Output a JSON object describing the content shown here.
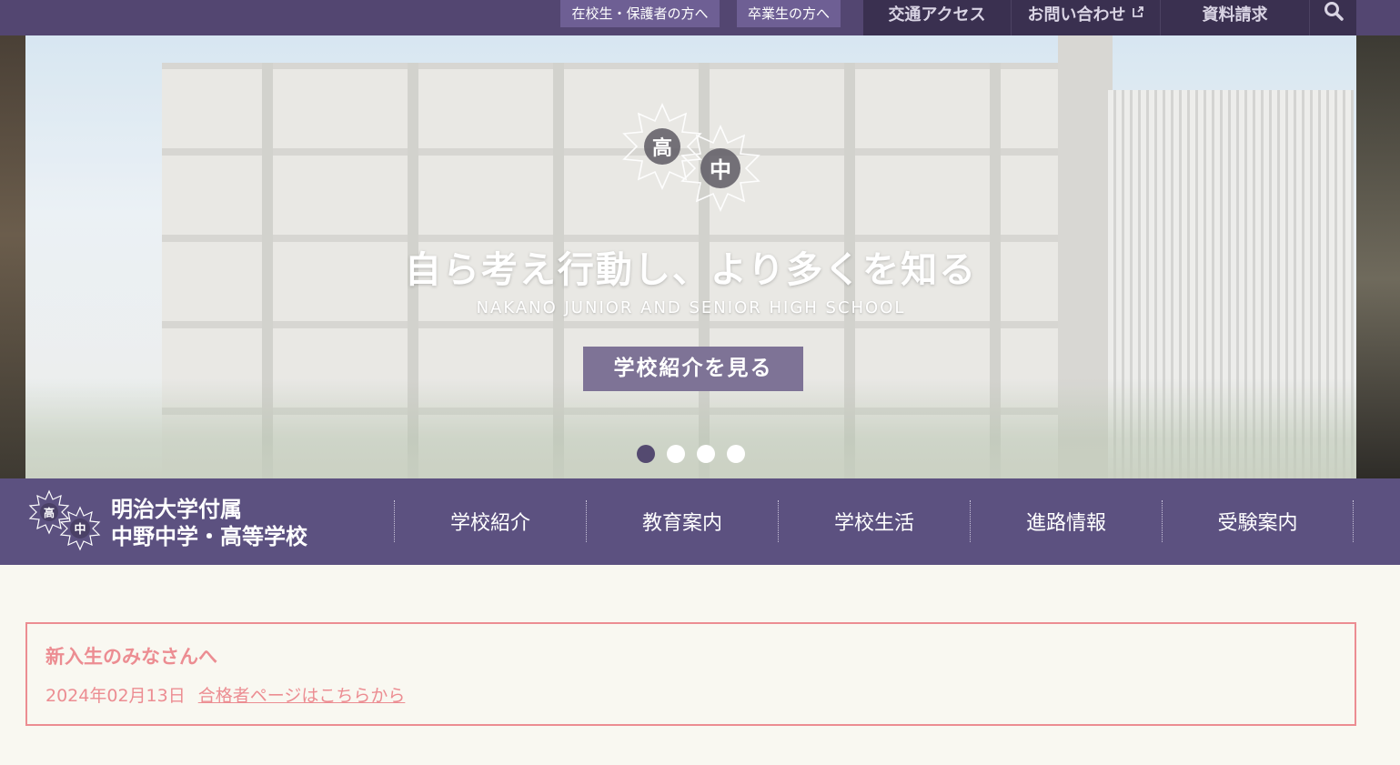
{
  "topbar": {
    "students_link": "在校生・保護者の方へ",
    "alumni_link": "卒業生の方へ",
    "access": "交通アクセス",
    "contact": "お問い合わせ",
    "brochure": "資料請求"
  },
  "hero": {
    "emblem_char_1": "高",
    "emblem_char_2": "中",
    "tagline": "自ら考え行動し、より多くを知る",
    "subline": "NAKANO JUNIOR AND SENIOR HIGH SCHOOL",
    "cta": "学校紹介を見る",
    "slides_total": 4,
    "slide_active": 1
  },
  "logo": {
    "line1": "明治大学付属",
    "line2": "中野中学・高等学校",
    "emblem_char_1": "高",
    "emblem_char_2": "中"
  },
  "nav": {
    "items": [
      {
        "label": "学校紹介"
      },
      {
        "label": "教育案内"
      },
      {
        "label": "学校生活"
      },
      {
        "label": "進路情報"
      },
      {
        "label": "受験案内"
      }
    ]
  },
  "notice": {
    "title": "新入生のみなさんへ",
    "date": "2024年02月13日",
    "link": "合格者ページはこちらから"
  },
  "colors": {
    "topbar": "#534671",
    "nav": "#5c5180",
    "accent_pink": "#ec8d92",
    "background": "#f9f8f1"
  }
}
